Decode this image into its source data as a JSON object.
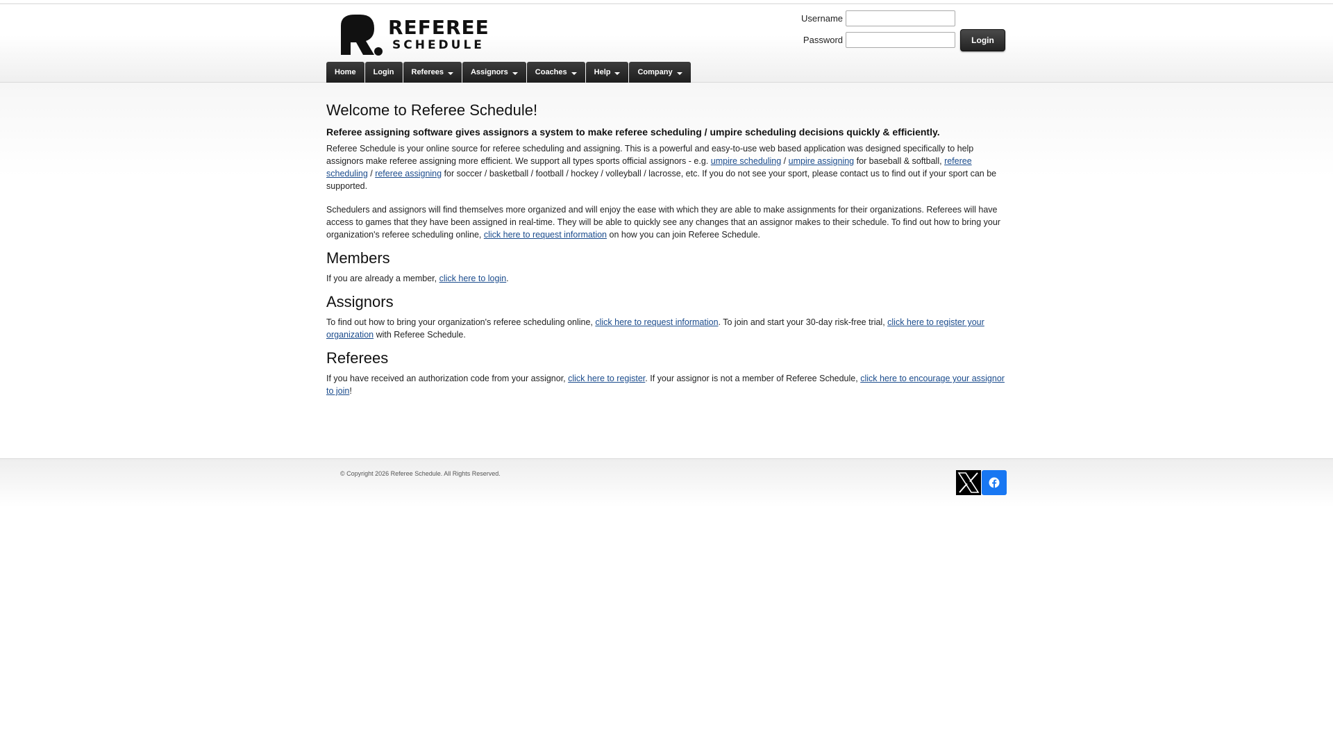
{
  "brand": {
    "line1": "REFEREE",
    "line2": "SCHEDULE"
  },
  "login": {
    "username_label": "Username",
    "username_value": "",
    "password_label": "Password",
    "password_value": "",
    "button_label": "Login"
  },
  "nav": {
    "items": [
      {
        "label": "Home",
        "dropdown": false
      },
      {
        "label": "Login",
        "dropdown": false
      },
      {
        "label": "Referees",
        "dropdown": true
      },
      {
        "label": "Assignors",
        "dropdown": true
      },
      {
        "label": "Coaches",
        "dropdown": true
      },
      {
        "label": "Help",
        "dropdown": true
      },
      {
        "label": "Company",
        "dropdown": true
      }
    ]
  },
  "main": {
    "title": "Welcome to Referee Schedule!",
    "lead": "Referee assigning software gives assignors a system to make referee scheduling / umpire scheduling decisions quickly & efficiently.",
    "intro": {
      "t1": "Referee Schedule is your online source for referee scheduling and assigning. This is a powerful and easy-to-use web based application was designed specifically to help assignors make referee assigning more efficient. We support all types sports official assignors - e.g. ",
      "link1": "umpire scheduling",
      "t2": " / ",
      "link2": "umpire assigning",
      "t3": " for baseball & softball, ",
      "link3": "referee scheduling",
      "t4": " / ",
      "link4": "referee assigning",
      "t5": " for soccer / basketball / football / hockey / volleyball / lacrosse, etc. If you do not see your sport, please contact us to find out if your sport can be supported."
    },
    "schedulers": {
      "t1": "Schedulers and assignors will find themselves more organized and will enjoy the ease with which they are able to make assignments for their organizations.  Referees will have access to games that they have been assigned in real-time. They will be able to quickly see any changes that an assignor makes to their schedule. To find out how to bring your organization's referee scheduling online, ",
      "link1": "click here to request information",
      "t2": " on how you can join Referee Schedule."
    },
    "members": {
      "heading": "Members",
      "t1": "If you are already a member, ",
      "link1": "click here to login",
      "t2": "."
    },
    "assignors": {
      "heading": "Assignors",
      "t1": "To find out how to bring your organization's referee scheduling online, ",
      "link1": "click here to request information",
      "t2": ". To join and start your 30-day risk-free trial, ",
      "link2": "click here to register your organization",
      "t3": " with Referee Schedule."
    },
    "referees": {
      "heading": "Referees",
      "t1": "If you have received an authorization code from your assignor, ",
      "link1": "click here to register",
      "t2": ". If your assignor is not a member of Referee Schedule, ",
      "link2": "click here to encourage your assignor to join",
      "t3": "!"
    }
  },
  "footer": {
    "copyright": "© Copyright 2026 Referee Schedule. All Rights Reserved.",
    "social": [
      {
        "icon": "x-twitter-icon",
        "color": "#000000"
      },
      {
        "icon": "facebook-icon",
        "color": "#1877f2"
      }
    ]
  }
}
